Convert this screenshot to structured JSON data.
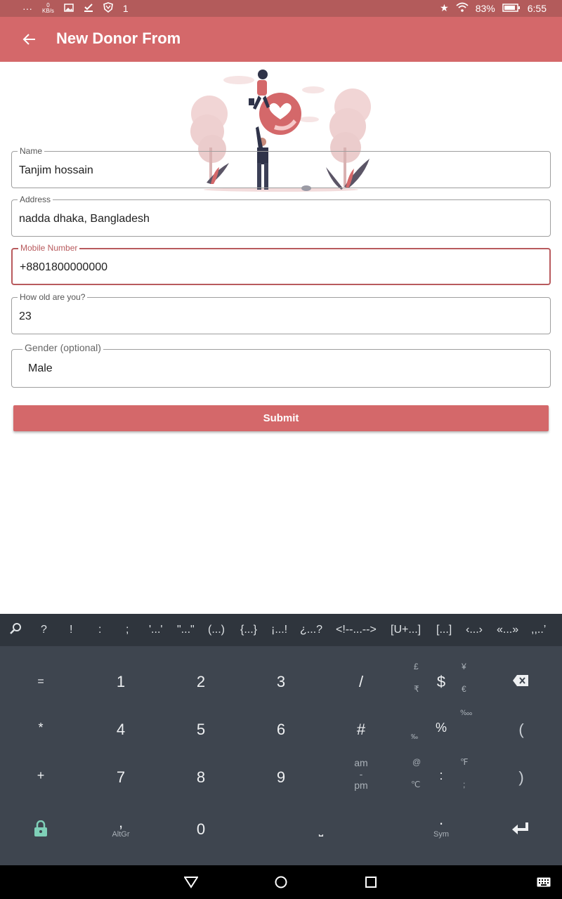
{
  "statusbar": {
    "dots": "···",
    "net_speed": "0",
    "net_unit": "KB/s",
    "sync": "1",
    "battery": "83%",
    "time": "6:55"
  },
  "appbar": {
    "title": "New Donor From"
  },
  "form": {
    "name": {
      "label": "Name",
      "value": "Tanjim hossain"
    },
    "address": {
      "label": "Address",
      "value": "nadda dhaka, Bangladesh"
    },
    "mobile": {
      "label": "Mobile Number",
      "value": "+8801800000000"
    },
    "age": {
      "label": "How old are you?",
      "value": "23"
    },
    "gender": {
      "label": "Gender (optional)",
      "value": "Male"
    },
    "submit_label": "Submit"
  },
  "keyboard": {
    "suggestions": [
      "?",
      "!",
      ":",
      ";",
      "'...'",
      "\"...\"",
      "(...)",
      "{...}",
      "¡...!",
      "¿...?",
      "<!--...-->",
      "[U+...]",
      "[...]",
      "‹...›",
      "«...»",
      ",,..’"
    ],
    "keys": {
      "equals": "=",
      "one": "1",
      "two": "2",
      "three": "3",
      "slash": "/",
      "dollar": "$",
      "pound": "£",
      "rupee": "₹",
      "yen": "¥",
      "euro": "€",
      "star": "*",
      "four": "4",
      "five": "5",
      "six": "6",
      "hash": "#",
      "percent": "%",
      "permyriad": "‱",
      "permille": "‰",
      "lparen": "(",
      "plus": "+",
      "seven": "7",
      "eight": "8",
      "nine": "9",
      "am": "am",
      "dash": "-",
      "pm": "pm",
      "at": "@",
      "celsius": "℃",
      "colon": ":",
      "fahrenheit": "℉",
      "semicolon": ";",
      "rparen": ")",
      "comma": ",",
      "altgr": "AltGr",
      "zero": "0",
      "space": "⎵",
      "period": ".",
      "sym": "Sym"
    }
  },
  "colors": {
    "primary": "#d4686a",
    "statusbar": "#b35b5b",
    "focus": "#b85a5d",
    "keyboard": "#3e454f"
  }
}
